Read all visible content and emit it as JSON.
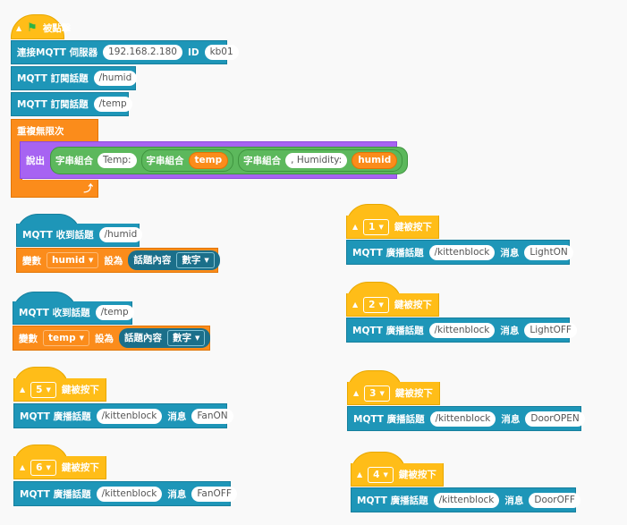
{
  "colors": {
    "blue": "#1e96b8",
    "orange": "#fb8c1b",
    "yellow": "#ffbd18",
    "purple": "#a763f2",
    "green": "#5cb85c"
  },
  "main": {
    "hat_label": "被點擊",
    "connect": {
      "label": "連接MQTT 伺服器",
      "ip": "192.168.2.180",
      "id_label": "ID",
      "id": "kb01"
    },
    "sub1": {
      "label": "MQTT 訂閱話題",
      "topic": "/humid"
    },
    "sub2": {
      "label": "MQTT 訂閱話題",
      "topic": "/temp"
    },
    "loop": {
      "label": "重複無限次"
    },
    "say": {
      "label": "說出",
      "join": "字串組合",
      "s1": "Temp:",
      "s2": "temp",
      "s3": ", Humidity:",
      "s4": "humid"
    }
  },
  "recv1": {
    "label": "MQTT 收到話題",
    "topic": "/humid",
    "set": "變數",
    "var": "humid",
    "to": "設為",
    "content": "話題內容",
    "type": "數字"
  },
  "recv2": {
    "label": "MQTT 收到話題",
    "topic": "/temp",
    "set": "變數",
    "var": "temp",
    "to": "設為",
    "content": "話題內容",
    "type": "數字"
  },
  "key_hats": [
    {
      "key": "5",
      "label": "鍵被按下",
      "pub": "MQTT 廣播話題",
      "topic": "/kittenblock",
      "msg_label": "消息",
      "msg": "FanON"
    },
    {
      "key": "6",
      "label": "鍵被按下",
      "pub": "MQTT 廣播話題",
      "topic": "/kittenblock",
      "msg_label": "消息",
      "msg": "FanOFF"
    },
    {
      "key": "1",
      "label": "鍵被按下",
      "pub": "MQTT 廣播話題",
      "topic": "/kittenblock",
      "msg_label": "消息",
      "msg": "LightON"
    },
    {
      "key": "2",
      "label": "鍵被按下",
      "pub": "MQTT 廣播話題",
      "topic": "/kittenblock",
      "msg_label": "消息",
      "msg": "LightOFF"
    },
    {
      "key": "3",
      "label": "鍵被按下",
      "pub": "MQTT 廣播話題",
      "topic": "/kittenblock",
      "msg_label": "消息",
      "msg": "DoorOPEN"
    },
    {
      "key": "4",
      "label": "鍵被按下",
      "pub": "MQTT 廣播話題",
      "topic": "/kittenblock",
      "msg_label": "消息",
      "msg": "DoorOFF"
    }
  ],
  "icons": {
    "flag": "green-flag-icon",
    "loop_arrow": "loop-arrow-icon",
    "dropdown": "caret-down-icon"
  }
}
